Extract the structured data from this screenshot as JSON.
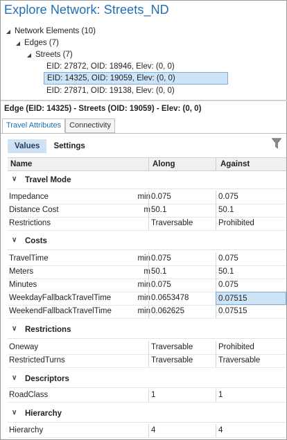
{
  "window": {
    "title": "Explore Network: Streets_ND"
  },
  "tree": {
    "root": "Network Elements (10)",
    "edges": "Edges (7)",
    "streets": "Streets (7)",
    "leaves": [
      "EID: 27872, OID: 18946, Elev: (0, 0)",
      "EID: 14325, OID: 19059, Elev: (0, 0)",
      "EID: 27871, OID: 19138, Elev: (0, 0)"
    ],
    "selected_index": 1
  },
  "detail": {
    "header": "Edge (EID: 14325) - Streets (OID: 19059) - Elev: (0, 0)"
  },
  "tabs": [
    "Travel Attributes",
    "Connectivity"
  ],
  "subtabs": [
    "Values",
    "Settings"
  ],
  "grid": {
    "columns": [
      "Name",
      "Along",
      "Against"
    ],
    "groups": [
      {
        "label": "Travel Mode",
        "rows": [
          {
            "name": "Impedance",
            "unit": "min",
            "along": "0.075",
            "against": "0.075"
          },
          {
            "name": "Distance Cost",
            "unit": "m",
            "along": "50.1",
            "against": "50.1"
          },
          {
            "name": "Restrictions",
            "unit": "",
            "along": "Traversable",
            "against": "Prohibited"
          }
        ]
      },
      {
        "label": "Costs",
        "rows": [
          {
            "name": "TravelTime",
            "unit": "min",
            "along": "0.075",
            "against": "0.075"
          },
          {
            "name": "Meters",
            "unit": "m",
            "along": "50.1",
            "against": "50.1"
          },
          {
            "name": "Minutes",
            "unit": "min",
            "along": "0.075",
            "against": "0.075"
          },
          {
            "name": "WeekdayFallbackTravelTime",
            "unit": "min",
            "along": "0.0653478",
            "against": "0.07515"
          },
          {
            "name": "WeekendFallbackTravelTime",
            "unit": "min",
            "along": "0.062625",
            "against": "0.07515"
          }
        ]
      },
      {
        "label": "Restrictions",
        "rows": [
          {
            "name": "Oneway",
            "unit": "",
            "along": "Traversable",
            "against": "Prohibited"
          },
          {
            "name": "RestrictedTurns",
            "unit": "",
            "along": "Traversable",
            "against": "Traversable"
          }
        ]
      },
      {
        "label": "Descriptors",
        "rows": [
          {
            "name": "RoadClass",
            "unit": "",
            "along": "1",
            "against": "1"
          }
        ]
      },
      {
        "label": "Hierarchy",
        "rows": [
          {
            "name": "Hierarchy",
            "unit": "",
            "along": "4",
            "against": "4"
          }
        ]
      }
    ]
  },
  "colors": {
    "accent": "#1f6db5",
    "selection": "#cde3f6",
    "selection_border": "#7aaede"
  },
  "icons": {
    "expand": "triangle-down-icon",
    "collapse": "chevron-down-icon",
    "filter": "filter-icon"
  }
}
